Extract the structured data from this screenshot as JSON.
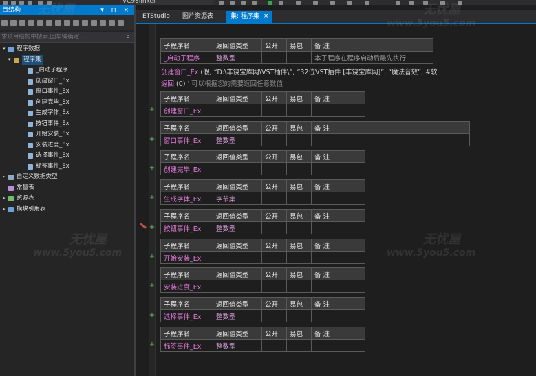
{
  "toolbar": {
    "combo_value": "VC98linker"
  },
  "left_panel": {
    "title": "目结构",
    "title_icons": "▾ ⊓ ×",
    "search_placeholder": "求项目结构中搜索,回车键确定...",
    "tree": [
      {
        "label": "程序数据",
        "level": 0,
        "expanded": true
      },
      {
        "label": "程序集",
        "level": 1,
        "expanded": true,
        "selected": true
      },
      {
        "label": "_启动子程序",
        "level": 2
      },
      {
        "label": "创建窗口_Ex",
        "level": 2
      },
      {
        "label": "窗口事件_Ex",
        "level": 2
      },
      {
        "label": "创建完毕_Ex",
        "level": 2
      },
      {
        "label": "生成字体_Ex",
        "level": 2
      },
      {
        "label": "按钮事件_Ex",
        "level": 2
      },
      {
        "label": "开始安装_Ex",
        "level": 2
      },
      {
        "label": "安装进度_Ex",
        "level": 2
      },
      {
        "label": "选择事件_Ex",
        "level": 2
      },
      {
        "label": "标签事件_Ex",
        "level": 2
      },
      {
        "label": "自定义数据类型",
        "level": 0,
        "collapsed": true
      },
      {
        "label": "常量表",
        "level": 0
      },
      {
        "label": "资源表",
        "level": 0,
        "collapsed": true
      },
      {
        "label": "模块引用表",
        "level": 0,
        "collapsed": true
      }
    ]
  },
  "tabs": [
    {
      "label": "ETStudio",
      "active": false
    },
    {
      "label": "图片资源表",
      "active": false
    },
    {
      "label": "集: 程序集",
      "active": true,
      "close": "×"
    }
  ],
  "header": {
    "name": "子程序名",
    "ret": "返回值类型",
    "pub": "公开",
    "pkg": "易包",
    "note": "备 注"
  },
  "editor": {
    "first_sub": {
      "name": "_启动子程序",
      "ret": "整数型",
      "note": "本子程序在程序启动后最先执行"
    },
    "code_line_1": {
      "func": "创建窗口_Ex",
      "args": " (假, “D:\\丰饶宝库网\\VST插件\\”, “32位VST插件 [丰饶宝库网]”, “魔法音效”, #软"
    },
    "code_line_2": {
      "kw": "返回",
      "val": " (0)  ",
      "comment": "' 可以根据您的需要返回任意数值"
    },
    "subs": [
      {
        "name": "创建窗口_Ex",
        "ret": ""
      },
      {
        "name": "窗口事件_Ex",
        "ret": "整数型"
      },
      {
        "name": "创建完毕_Ex",
        "ret": ""
      },
      {
        "name": "生成字体_Ex",
        "ret": "字节集"
      },
      {
        "name": "按钮事件_Ex",
        "ret": "整数型"
      },
      {
        "name": "开始安装_Ex",
        "ret": ""
      },
      {
        "name": "安装进度_Ex",
        "ret": ""
      },
      {
        "name": "选择事件_Ex",
        "ret": "整数型"
      },
      {
        "name": "标签事件_Ex",
        "ret": "整数型"
      }
    ],
    "expand_glyph": "+"
  },
  "watermark": {
    "brand": "无忧屋",
    "url": "www.5you5.com"
  }
}
